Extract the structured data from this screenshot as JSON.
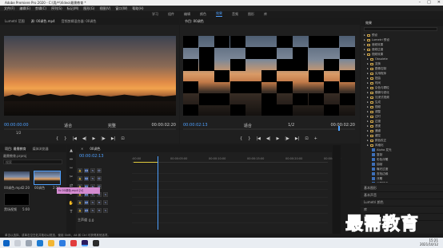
{
  "titlebar": {
    "title": "Adobe Premiere Pro 2020 - C:\\用户\\Video\\最需教育 *",
    "minimize": "–",
    "maximize": "□",
    "close": "✕"
  },
  "menu": [
    "文件(F)",
    "编辑(E)",
    "剪辑(C)",
    "序列(S)",
    "标记(M)",
    "图形(G)",
    "视图(V)",
    "窗口(W)",
    "帮助(H)"
  ],
  "workspaces": [
    {
      "label": "学习",
      "active": false
    },
    {
      "label": "组件",
      "active": false
    },
    {
      "label": "编辑",
      "active": false
    },
    {
      "label": "颜色",
      "active": false
    },
    {
      "label": "效果",
      "active": true
    },
    {
      "label": "音频",
      "active": false
    },
    {
      "label": "图形",
      "active": false
    },
    {
      "label": "库",
      "active": false
    }
  ],
  "source_panel": {
    "tabs": [
      "Lumetri 范围",
      "源: 00调色.mp4",
      "音频剪辑混合器: 00调色"
    ],
    "timecode": "00:00:00:00",
    "fit": "适合",
    "quality": "完整",
    "end_timecode": "00:00:02:20",
    "page_indicator": "1/2"
  },
  "program_panel": {
    "tab": "节目: 00调色",
    "timecode": "00:00:02:13",
    "fit": "适合",
    "quality": "1/2",
    "end_timecode": "00:00:02:20"
  },
  "transport": {
    "mark_in": "{",
    "mark_out": "}",
    "go_in": "|◀",
    "step_back": "◀|",
    "play": "▶",
    "step_fwd": "|▶",
    "go_out": "▶|",
    "export_frame": "⊡",
    "settings": "+"
  },
  "projects": {
    "tabs": [
      "项目: 最需教育",
      "媒体浏览器"
    ],
    "search_placeholder": "搜索",
    "project_file": "最需教育.prproj",
    "items": [
      {
        "label": "00调色.mp4",
        "duration": "2:20"
      },
      {
        "label": "00调色",
        "duration": "2:20"
      },
      {
        "label": "黑场视频",
        "duration": "5:00"
      }
    ]
  },
  "tools": [
    "▲",
    "⇔",
    "⇿",
    "✂",
    "⇄",
    "✒",
    "✋",
    "T"
  ],
  "timeline": {
    "tab": "00调色",
    "timecode": "00:00:02:13",
    "ruler_labels": [
      ":00:00",
      "00:00:05:00",
      "00:00:10:00",
      "00:00:15:00",
      "00:00:20:00",
      "00:00:25:00"
    ],
    "tracks": [
      {
        "name": "V3",
        "kind": "video"
      },
      {
        "name": "V2",
        "kind": "video"
      },
      {
        "name": "V1",
        "kind": "video"
      },
      {
        "name": "A1",
        "kind": "audio"
      },
      {
        "name": "A2",
        "kind": "audio"
      },
      {
        "name": "A3",
        "kind": "audio"
      },
      {
        "name": "主声道",
        "kind": "master",
        "value": "0.0"
      }
    ],
    "clip_label": "fx 00调色.mp4 [V]"
  },
  "effects_panel": {
    "tab": "效果",
    "items": [
      {
        "label": "预设",
        "type": "folder",
        "indent": 0,
        "selected": false
      },
      {
        "label": "Lumetri 预设",
        "type": "folder",
        "indent": 0,
        "selected": false
      },
      {
        "label": "音频效果",
        "type": "folder",
        "indent": 0,
        "selected": false
      },
      {
        "label": "音频过渡",
        "type": "folder",
        "indent": 0,
        "selected": false
      },
      {
        "label": "视频效果",
        "type": "folder",
        "indent": 0,
        "selected": false
      },
      {
        "label": "Obsolete",
        "type": "folder",
        "indent": 1,
        "selected": false
      },
      {
        "label": "变换",
        "type": "folder",
        "indent": 1,
        "selected": false
      },
      {
        "label": "图像控制",
        "type": "folder",
        "indent": 1,
        "selected": false
      },
      {
        "label": "实用程序",
        "type": "folder",
        "indent": 1,
        "selected": false
      },
      {
        "label": "扭曲",
        "type": "folder",
        "indent": 1,
        "selected": false
      },
      {
        "label": "时间",
        "type": "folder",
        "indent": 1,
        "selected": false
      },
      {
        "label": "杂色与颗粒",
        "type": "folder",
        "indent": 1,
        "selected": false
      },
      {
        "label": "模糊与锐化",
        "type": "folder",
        "indent": 1,
        "selected": false
      },
      {
        "label": "沉浸式视频",
        "type": "folder",
        "indent": 1,
        "selected": false
      },
      {
        "label": "生成",
        "type": "folder",
        "indent": 1,
        "selected": false
      },
      {
        "label": "视频",
        "type": "folder",
        "indent": 1,
        "selected": false
      },
      {
        "label": "调整",
        "type": "folder",
        "indent": 1,
        "selected": false
      },
      {
        "label": "过时",
        "type": "folder",
        "indent": 1,
        "selected": false
      },
      {
        "label": "过渡",
        "type": "folder",
        "indent": 1,
        "selected": false
      },
      {
        "label": "透视",
        "type": "folder",
        "indent": 1,
        "selected": false
      },
      {
        "label": "通道",
        "type": "folder",
        "indent": 1,
        "selected": false
      },
      {
        "label": "键控",
        "type": "folder",
        "indent": 1,
        "selected": false
      },
      {
        "label": "颜色校正",
        "type": "folder",
        "indent": 1,
        "selected": false
      },
      {
        "label": "风格化",
        "type": "folder",
        "indent": 1,
        "selected": false
      },
      {
        "label": "Alpha 发光",
        "type": "effect",
        "indent": 2,
        "selected": false
      },
      {
        "label": "复制",
        "type": "effect",
        "indent": 2,
        "selected": false
      },
      {
        "label": "彩色浮雕",
        "type": "effect",
        "indent": 2,
        "selected": false
      },
      {
        "label": "抽帧",
        "type": "effect",
        "indent": 2,
        "selected": false
      },
      {
        "label": "曝光过度",
        "type": "effect",
        "indent": 2,
        "selected": false
      },
      {
        "label": "查找边缘",
        "type": "effect",
        "indent": 2,
        "selected": false
      },
      {
        "label": "浮雕",
        "type": "effect",
        "indent": 2,
        "selected": false
      },
      {
        "label": "画笔描边",
        "type": "effect",
        "indent": 2,
        "selected": false
      },
      {
        "label": "粗糙边缘",
        "type": "effect",
        "indent": 2,
        "selected": false
      },
      {
        "label": "纹理化",
        "type": "effect",
        "indent": 2,
        "selected": false
      },
      {
        "label": "闪光灯",
        "type": "effect",
        "indent": 2,
        "selected": false
      },
      {
        "label": "阈值",
        "type": "effect",
        "indent": 2,
        "selected": false
      },
      {
        "label": "马赛克",
        "type": "effect",
        "indent": 2,
        "selected": true
      },
      {
        "label": "视频过渡",
        "type": "folder",
        "indent": 0,
        "selected": false
      },
      {
        "label": "3D 运动",
        "type": "folder",
        "indent": 1,
        "selected": false
      },
      {
        "label": "内滑",
        "type": "folder",
        "indent": 1,
        "selected": false
      },
      {
        "label": "划像",
        "type": "folder",
        "indent": 1,
        "selected": false
      },
      {
        "label": "擦除",
        "type": "folder",
        "indent": 1,
        "selected": false
      }
    ],
    "lower_tabs": [
      "基本图形",
      "基本声音",
      "Lumetri 颜色",
      "库",
      "标记"
    ]
  },
  "status": "单击以选择，或单击空白处并拖动以框选，使用 Shift、Alt 和 Ctrl 可获得其他选项。",
  "taskbar": {
    "time": "15:21",
    "date": "2021/10/12"
  },
  "watermark": "最需教育",
  "colors": {
    "accent": "#4ea0ff",
    "clip": "#d48bd0",
    "watermark": "#2b40b6"
  }
}
